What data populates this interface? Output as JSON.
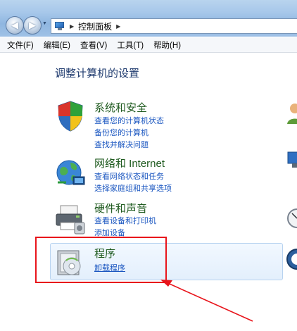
{
  "address": {
    "breadcrumb": [
      "控制面板"
    ]
  },
  "menu": [
    "文件(F)",
    "编辑(E)",
    "查看(V)",
    "工具(T)",
    "帮助(H)"
  ],
  "main": {
    "heading": "调整计算机的设置",
    "categories": [
      {
        "title": "系统和安全",
        "links": [
          "查看您的计算机状态",
          "备份您的计算机",
          "查找并解决问题"
        ],
        "icon": "shield-icon"
      },
      {
        "title": "网络和 Internet",
        "links": [
          "查看网络状态和任务",
          "选择家庭组和共享选项"
        ],
        "icon": "network-globe-icon"
      },
      {
        "title": "硬件和声音",
        "links": [
          "查看设备和打印机",
          "添加设备"
        ],
        "icon": "printer-icon"
      },
      {
        "title": "程序",
        "links": [
          "卸载程序"
        ],
        "icon": "programs-icon"
      }
    ]
  },
  "annotation": {
    "color": "#e8141b"
  },
  "colors": {
    "title_green": "#1e5a1e",
    "link_blue": "#1a56c0",
    "heading_blue": "#1e3a6e"
  }
}
